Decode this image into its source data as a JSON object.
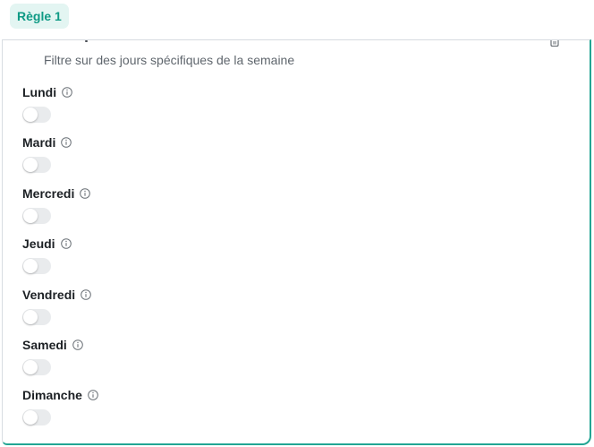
{
  "tab": {
    "label": "Règle 1"
  },
  "card": {
    "subtitle": "Filtre sur des jours spécifiques de la semaine",
    "days": [
      {
        "label": "Lundi",
        "enabled": false
      },
      {
        "label": "Mardi",
        "enabled": false
      },
      {
        "label": "Mercredi",
        "enabled": false
      },
      {
        "label": "Jeudi",
        "enabled": false
      },
      {
        "label": "Vendredi",
        "enabled": false
      },
      {
        "label": "Samedi",
        "enabled": false
      },
      {
        "label": "Dimanche",
        "enabled": false
      }
    ]
  },
  "colors": {
    "accent": "#0f9a85",
    "accent_bg": "#e3f5f2",
    "border_accent": "#22a593",
    "toggle_off": "#e9ebed"
  },
  "icons": {
    "info": "info-circle-icon",
    "delete": "trash-icon"
  }
}
